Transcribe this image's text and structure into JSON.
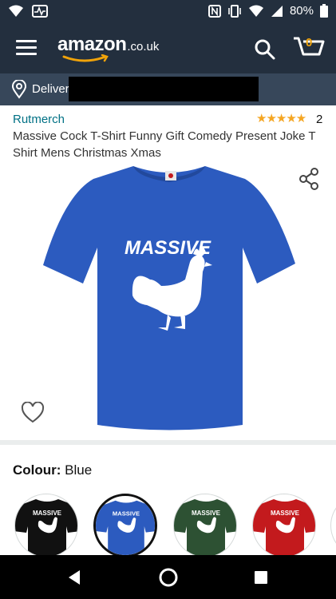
{
  "status": {
    "battery": "80%"
  },
  "header": {
    "logo_word": "amazon",
    "logo_tld": ".co.uk",
    "cart_count": "0"
  },
  "deliver": {
    "label": "Deliver"
  },
  "product": {
    "brand": "Rutmerch",
    "rating_count": "2",
    "title": "Massive Cock T-Shirt Funny Gift Comedy Present Joke T Shirt Mens Christmas Xmas",
    "shirt_text": "MASSIVE"
  },
  "colour": {
    "label": "Colour:",
    "value": "Blue"
  },
  "swatches": [
    {
      "name": "Black",
      "color": "#111111",
      "text": "MASSIVE"
    },
    {
      "name": "Blue",
      "color": "#2c5bbf",
      "text": "MASSIVE"
    },
    {
      "name": "Green",
      "color": "#2d5133",
      "text": "MASSIVE"
    },
    {
      "name": "Red",
      "color": "#c31a1d",
      "text": "MASSIVE"
    }
  ],
  "colors": {
    "nav": "#232f3e",
    "deliver": "#37475a",
    "brand_link": "#007185",
    "star": "#f5a623",
    "shirt": "#2c5bbf"
  }
}
